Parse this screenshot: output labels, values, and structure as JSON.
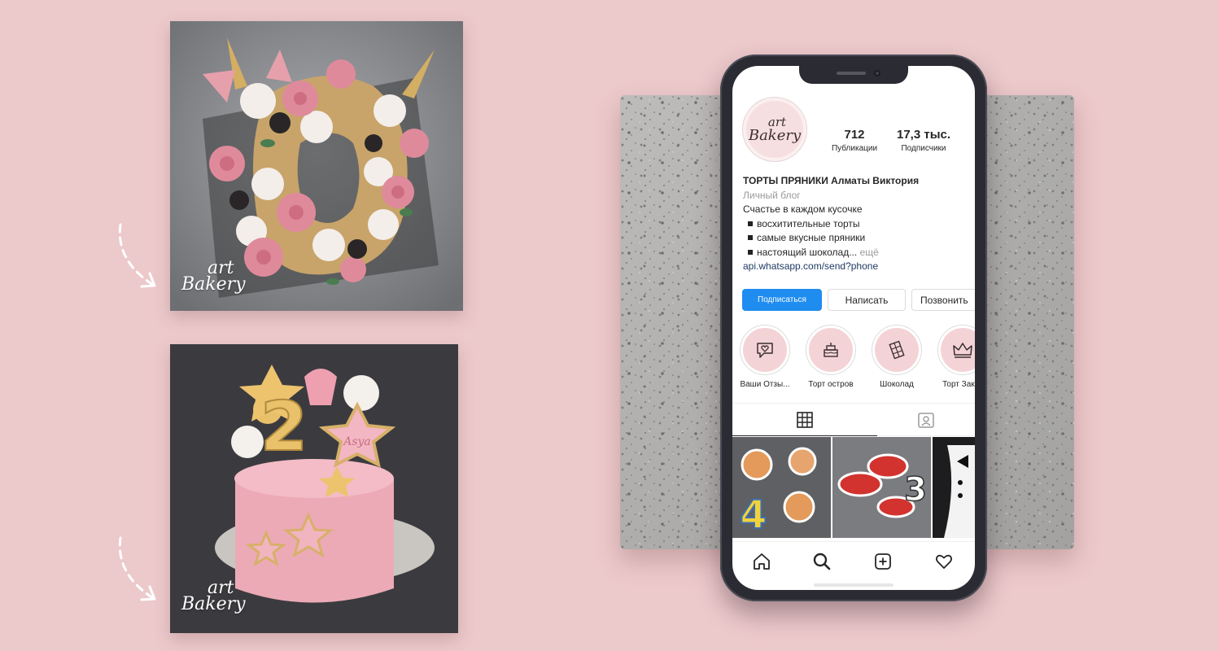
{
  "colors": {
    "background": "#ecc9cb",
    "follow_button": "#1f8cf0",
    "highlight_disc": "#f4d3d6",
    "phone_frame": "#2b2c33"
  },
  "photo_cards": [
    {
      "logo_line1": "art",
      "logo_line2": "Bakery",
      "icon": "curved-arrow-icon"
    },
    {
      "logo_line1": "art",
      "logo_line2": "Bakery",
      "icon": "curved-arrow-icon"
    }
  ],
  "cake_topper_text": "2",
  "cake_star_text": "Asya",
  "profile": {
    "avatar_line1": "art",
    "avatar_line2": "Bakery",
    "posts_count": "712",
    "posts_label": "Публикации",
    "followers_count": "17,3 тыс.",
    "followers_label": "Подписчики",
    "name": "ТОРТЫ ПРЯНИКИ Алматы Виктория",
    "category": "Личный блог",
    "bio_line1": "Счастье в каждом кусочке",
    "bio_bullets": [
      "восхитительные торты",
      "самые вкусные пряники",
      "настоящий шоколад..."
    ],
    "more_label": "ещё",
    "link": "api.whatsapp.com/send?phone"
  },
  "buttons": {
    "follow": "Подписаться",
    "message": "Написать",
    "call": "Позвонить"
  },
  "highlights": [
    {
      "label": "Ваши Отзы...",
      "icon": "chat-heart-icon"
    },
    {
      "label": "Торт остров",
      "icon": "cake-icon"
    },
    {
      "label": "Шоколад",
      "icon": "chocolate-icon"
    },
    {
      "label": "Торт Заказ",
      "icon": "crown-icon"
    }
  ],
  "grid_tiles": [
    {
      "topper_text": "4"
    },
    {
      "topper_text": "3"
    },
    {
      "topper_text": ""
    }
  ],
  "nav_icons": [
    "home-icon",
    "search-icon",
    "add-icon",
    "heart-icon"
  ]
}
